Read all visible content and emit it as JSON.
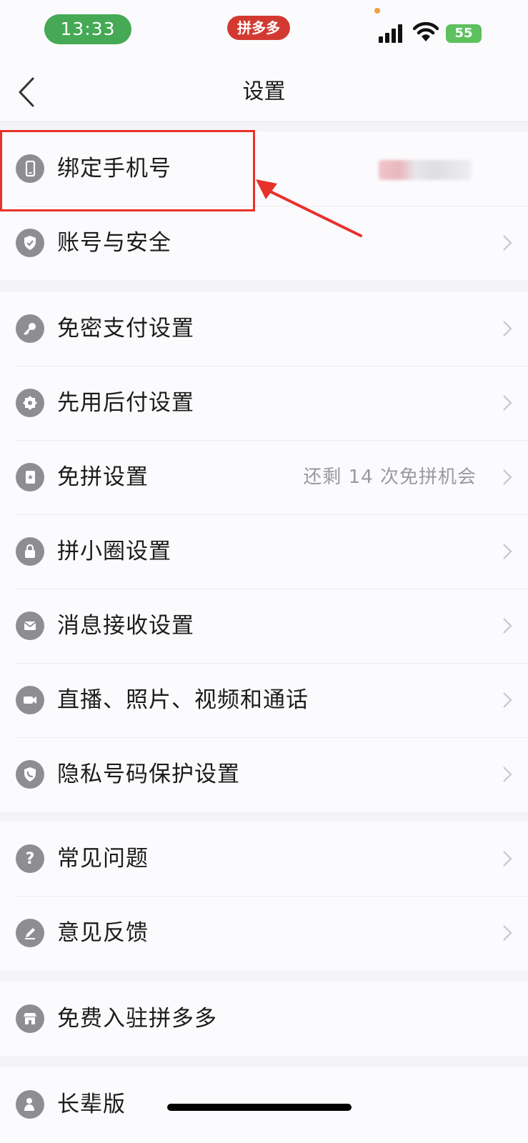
{
  "status_bar": {
    "time": "13:33",
    "app_name": "拼多多",
    "battery": "55",
    "signal_icon": "cellular-signal-icon",
    "wifi_icon": "wifi-icon"
  },
  "nav": {
    "title": "设置",
    "back_icon": "chevron-left-icon"
  },
  "groups": [
    {
      "items": [
        {
          "label": "绑定手机号",
          "icon": "phone-icon",
          "value": "",
          "highlighted": true
        },
        {
          "label": "账号与安全",
          "icon": "shield-check-icon",
          "value": ""
        }
      ]
    },
    {
      "items": [
        {
          "label": "免密支付设置",
          "icon": "key-icon",
          "value": ""
        },
        {
          "label": "先用后付设置",
          "icon": "badge-icon",
          "value": ""
        },
        {
          "label": "免拼设置",
          "icon": "card-star-icon",
          "value": "还剩 14 次免拼机会"
        },
        {
          "label": "拼小圈设置",
          "icon": "lock-icon",
          "value": ""
        },
        {
          "label": "消息接收设置",
          "icon": "envelope-icon",
          "value": ""
        },
        {
          "label": "直播、照片、视频和通话",
          "icon": "video-camera-icon",
          "value": ""
        },
        {
          "label": "隐私号码保护设置",
          "icon": "privacy-shield-phone-icon",
          "value": ""
        }
      ]
    },
    {
      "items": [
        {
          "label": "常见问题",
          "icon": "question-icon",
          "value": ""
        },
        {
          "label": "意见反馈",
          "icon": "pencil-icon",
          "value": ""
        }
      ]
    },
    {
      "items": [
        {
          "label": "免费入驻拼多多",
          "icon": "store-icon",
          "value": ""
        }
      ]
    },
    {
      "items": [
        {
          "label": "长辈版",
          "icon": "elder-icon",
          "value": ""
        }
      ]
    }
  ],
  "colors": {
    "highlight": "#e8312a",
    "time_pill": "#45a955",
    "app_pill": "#d23a31",
    "battery": "#5cc15e"
  }
}
